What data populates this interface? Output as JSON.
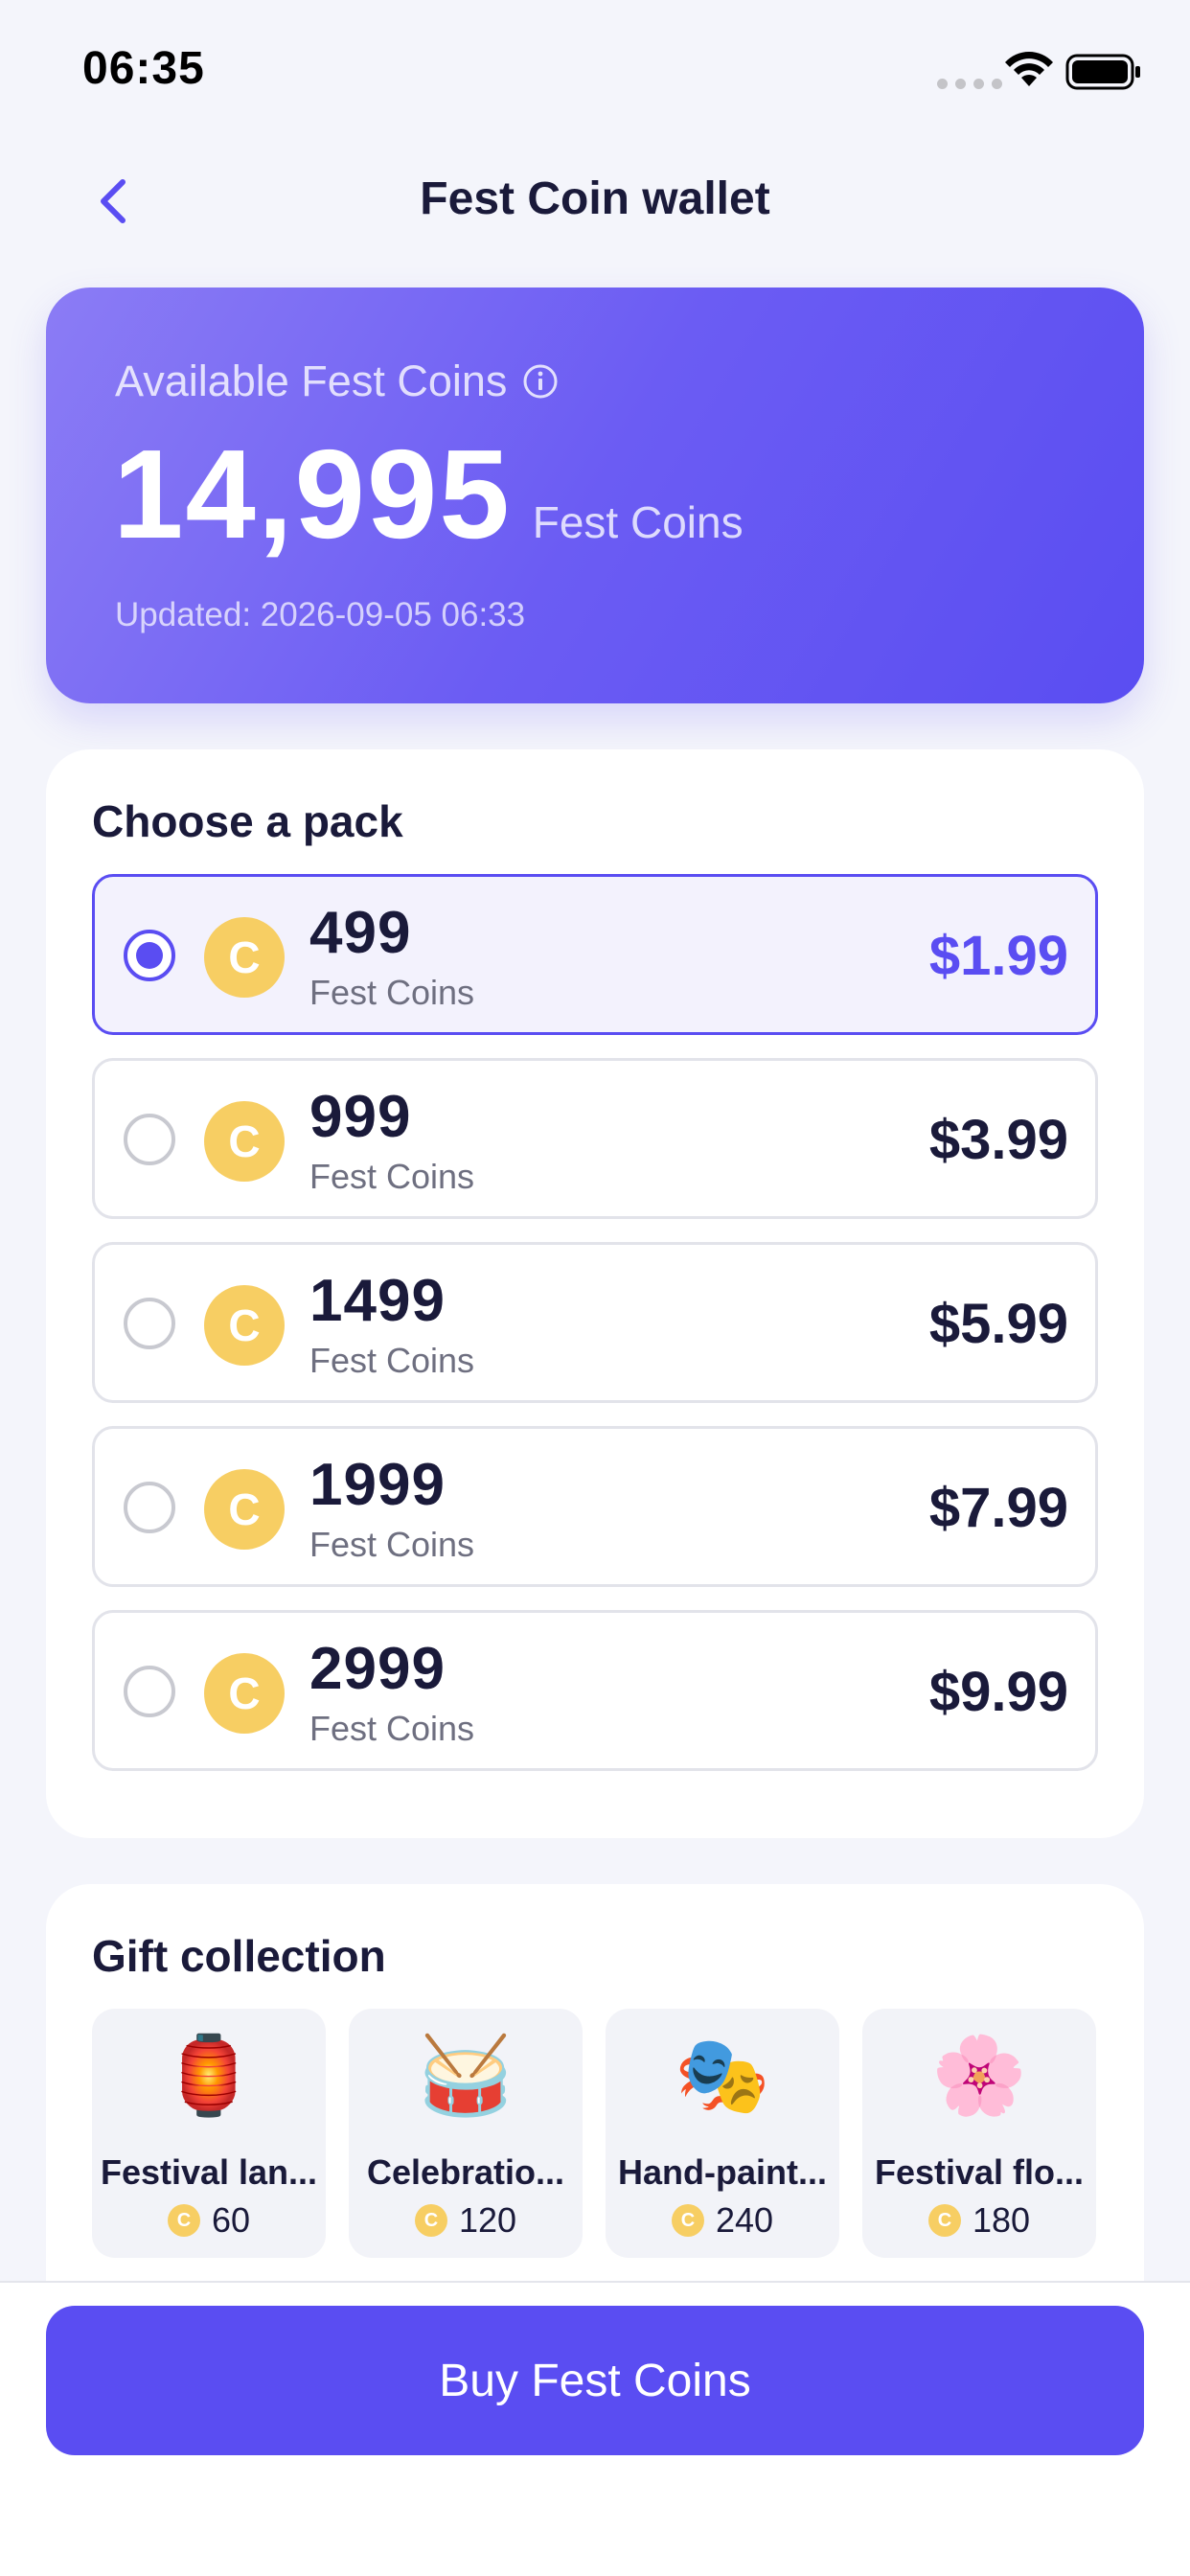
{
  "status_bar": {
    "time": "06:35"
  },
  "nav": {
    "title": "Fest Coin wallet"
  },
  "balance": {
    "label": "Available Fest Coins",
    "amount": "14,995",
    "unit": "Fest Coins",
    "updated": "Updated: 2026-09-05 06:33"
  },
  "packs": {
    "title": "Choose a pack",
    "items": [
      {
        "amount": "499",
        "unit": "Fest Coins",
        "price": "$1.99",
        "selected": true
      },
      {
        "amount": "999",
        "unit": "Fest Coins",
        "price": "$3.99",
        "selected": false
      },
      {
        "amount": "1499",
        "unit": "Fest Coins",
        "price": "$5.99",
        "selected": false
      },
      {
        "amount": "1999",
        "unit": "Fest Coins",
        "price": "$7.99",
        "selected": false
      },
      {
        "amount": "2999",
        "unit": "Fest Coins",
        "price": "$9.99",
        "selected": false
      }
    ],
    "coin_letter": "C"
  },
  "gifts": {
    "title": "Gift collection",
    "items": [
      {
        "icon": "lantern-icon",
        "emoji": "🏮",
        "name": "Festival lan...",
        "price": "60"
      },
      {
        "icon": "drum-icon",
        "emoji": "🥁",
        "name": "Celebratio...",
        "price": "120"
      },
      {
        "icon": "theater-masks-icon",
        "emoji": "🎭",
        "name": "Hand-paint...",
        "price": "240"
      },
      {
        "icon": "flower-icon",
        "emoji": "🌸",
        "name": "Festival flo...",
        "price": "180"
      }
    ]
  },
  "buy_button": {
    "label": "Buy Fest Coins"
  },
  "colors": {
    "accent": "#5A4DF2",
    "coin": "#F7CE63",
    "background": "#F4F5FB"
  }
}
